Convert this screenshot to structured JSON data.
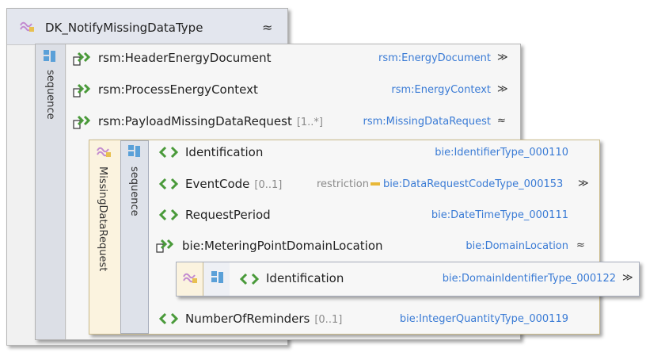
{
  "root": {
    "title": "DK_NotifyMissingDataType",
    "expand": "≈"
  },
  "outer_sequence": {
    "label": "sequence",
    "rows": [
      {
        "name": "rsm:HeaderEnergyDocument",
        "type": "rsm:EnergyDocument",
        "toggle": "≫"
      },
      {
        "name": "rsm:ProcessEnergyContext",
        "type": "rsm:EnergyContext",
        "toggle": "≫"
      },
      {
        "name": "rsm:PayloadMissingDataRequest",
        "multiplicity": "[1..*]",
        "type": "rsm:MissingDataRequest",
        "toggle": "≈"
      }
    ]
  },
  "inner": {
    "type_label": "MissingDataRequest",
    "sequence_label": "sequence",
    "rows": [
      {
        "name": "Identification",
        "type": "bie:IdentifierType_000110"
      },
      {
        "name": "EventCode",
        "multiplicity": "[0..1]",
        "restriction": "restriction",
        "type": "bie:DataRequestCodeType_000153",
        "toggle": "≫"
      },
      {
        "name": "RequestPeriod",
        "type": "bie:DateTimeType_000111"
      },
      {
        "name": "bie:MeteringPointDomainLocation",
        "type": "bie:DomainLocation",
        "toggle": "≈"
      },
      {
        "name": "NumberOfReminders",
        "multiplicity": "[0..1]",
        "type": "bie:IntegerQuantityType_000119"
      }
    ],
    "nested": {
      "name": "Identification",
      "type": "bie:DomainIdentifierType_000122",
      "toggle": "≫"
    }
  }
}
